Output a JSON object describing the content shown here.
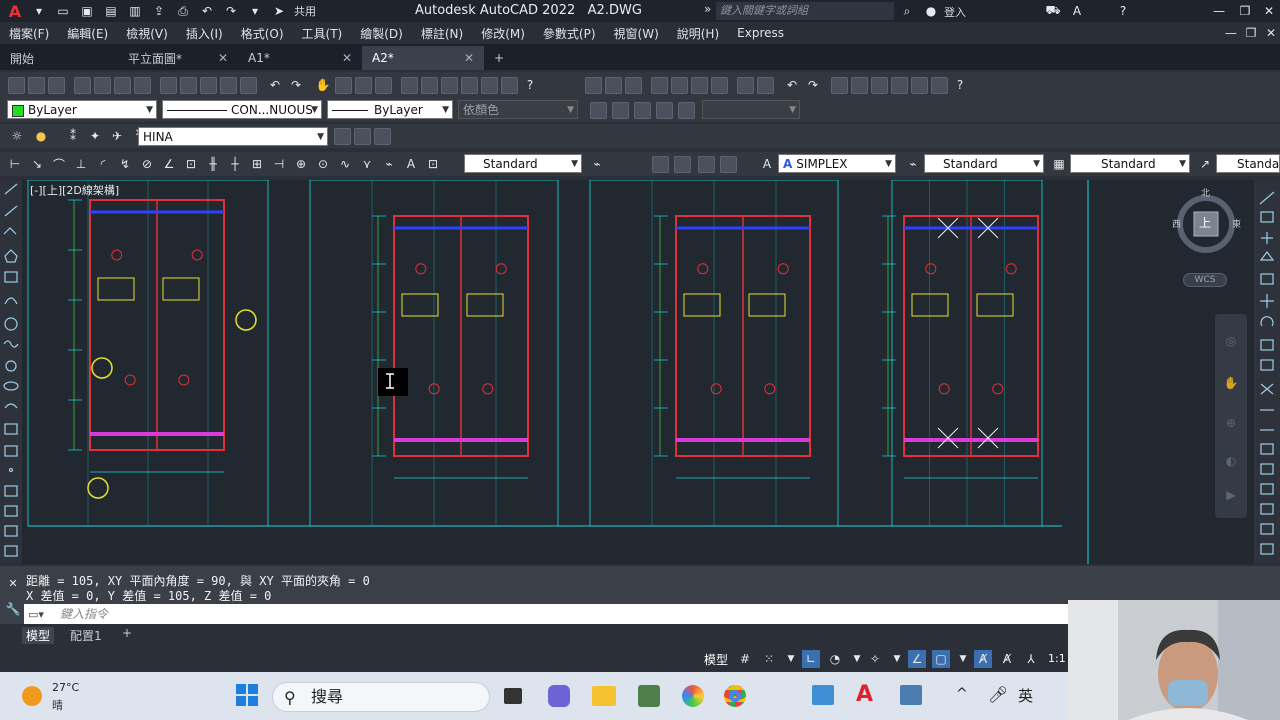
{
  "titlebar": {
    "app": "Autodesk AutoCAD 2022",
    "file": "A2.DWG",
    "share_label": "共用",
    "search_placeholder": "鍵入關鍵字或詞組",
    "signin_label": "登入"
  },
  "menu": [
    "檔案(F)",
    "編輯(E)",
    "檢視(V)",
    "插入(I)",
    "格式(O)",
    "工具(T)",
    "繪製(D)",
    "標註(N)",
    "修改(M)",
    "參數式(P)",
    "視窗(W)",
    "說明(H)",
    "Express"
  ],
  "tabs": [
    {
      "label": "開始",
      "closable": false,
      "active": false
    },
    {
      "label": "平立面圖*",
      "closable": true,
      "active": false
    },
    {
      "label": "A1*",
      "closable": true,
      "active": false
    },
    {
      "label": "A2*",
      "closable": true,
      "active": true
    }
  ],
  "properties": {
    "color": "ByLayer",
    "linetype": "CON...NUOUS",
    "lineweight": "ByLayer",
    "plotstyle": "依顏色",
    "layer": "HINA"
  },
  "styles": {
    "dim_style": "Standard",
    "text_font": "SIMPLEX",
    "table_style": "Standard",
    "mleader_style": "Standard",
    "extra_style": "Standard"
  },
  "viewport": {
    "label": "[-][上][2D線架構]",
    "viewcube_top": "上",
    "compass": {
      "n": "北",
      "s": "南",
      "e": "東",
      "w": "西"
    },
    "wcs": "WCS"
  },
  "command": {
    "line1": "距離 = 105, XY 平面內角度 = 90, 與 XY 平面的夾角 = 0",
    "line2": "X 差值 =   0, Y 差值 = 105, Z 差值 = 0",
    "input_placeholder": "鍵入指令"
  },
  "layout_tabs": [
    "模型",
    "配置1"
  ],
  "status": {
    "model_label": "模型",
    "scale": "1:1"
  },
  "taskbar": {
    "weather_temp": "27°C",
    "weather_desc": "晴",
    "search_label": "搜尋",
    "ime": "英"
  },
  "colors": {
    "accent_cyan": "#19d8e0",
    "wall_red": "#e0303a",
    "magenta": "#d93ad9",
    "yellow": "#e8e030",
    "green": "#30e050",
    "blue": "#3040ff"
  }
}
